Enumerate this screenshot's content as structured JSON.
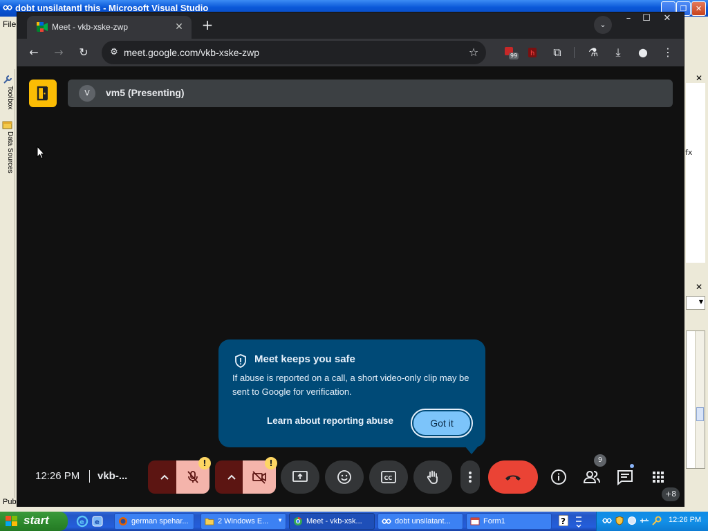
{
  "vs": {
    "title": "dobt unsilatantl this - Microsoft Visual Studio",
    "menu_file": "File",
    "toolbox_tab": "Toolbox",
    "data_sources_tab": "Data Sources",
    "bottom_left_text": "Pub",
    "fx_text": "fx"
  },
  "chrome": {
    "tab_title": "Meet - vkb-xske-zwp",
    "url": "meet.google.com/vkb-xske-zwp",
    "extension_badge": "99"
  },
  "meet": {
    "presenter_initial": "V",
    "presenter_label": "vm5 (Presenting)",
    "popup": {
      "title": "Meet keeps you safe",
      "body": "If abuse is reported on a call, a short video-only clip may be sent to Google for verification.",
      "link": "Learn about reporting abuse",
      "button": "Got it"
    },
    "time": "12:26 PM",
    "meeting_code": "vkb-...",
    "warning_mark": "!",
    "people_count": "9",
    "more_people": "+8"
  },
  "taskbar": {
    "start_label": "start",
    "tasks": [
      {
        "label": "german spehar...",
        "active": false
      },
      {
        "label": "2 Windows E...",
        "active": false
      },
      {
        "label": "Meet - vkb-xsk...",
        "active": true
      },
      {
        "label": "dobt unsilatant...",
        "active": false
      },
      {
        "label": "Form1",
        "active": false
      }
    ],
    "clock": "12:26 PM"
  },
  "colors": {
    "meet_bg": "#111111",
    "popup_bg": "#004a77",
    "end_call": "#ea4335",
    "muted_control": "#f4b4ab",
    "warning": "#fdd663"
  }
}
